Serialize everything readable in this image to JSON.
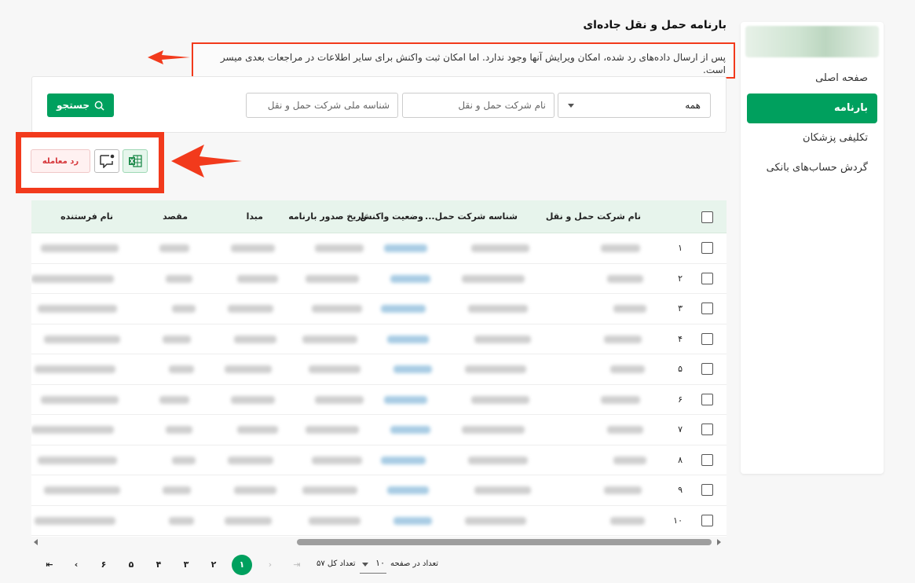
{
  "sidebar": {
    "items": [
      {
        "label": "صفحه اصلی",
        "active": false
      },
      {
        "label": "بارنامه",
        "active": true
      },
      {
        "label": "تکلیفی پزشکان",
        "active": false
      },
      {
        "label": "گردش حساب‌های بانکی",
        "active": false
      }
    ]
  },
  "header": {
    "title": "بارنامه حمل و نقل جاده‌ای",
    "notice": "پس از ارسال داده‌های رد شده، امکان ویرایش آنها وجود ندارد. اما امکان ثبت واکنش برای سایر اطلاعات در مراجعات بعدی میسر است."
  },
  "search": {
    "status_value": "همه",
    "company_placeholder": "نام شرکت حمل و نقل",
    "national_id_placeholder": "شناسه ملی شرکت حمل و نقل",
    "search_label": "جستجو"
  },
  "actions": {
    "reject_label": "رد معامله"
  },
  "table": {
    "columns": [
      "نام شرکت حمل و نقل",
      "شناسه شرکت حمل...",
      "وضعیت واکنش",
      "تاریخ صدور بارنامه",
      "مبدا",
      "مقصد",
      "نام فرستنده"
    ],
    "row_numbers": [
      "۱",
      "۲",
      "۳",
      "۴",
      "۵",
      "۶",
      "۷",
      "۸",
      "۹",
      "۱۰"
    ]
  },
  "pagination": {
    "pages": [
      "۶",
      "۵",
      "۴",
      "۳",
      "۲",
      "۱"
    ],
    "current": "۱",
    "page_size_label": "تعداد در صفحه",
    "page_size": "۱۰",
    "total_label": "تعداد کل ۵۷"
  },
  "colors": {
    "accent": "#00a05e",
    "highlight": "#f23a1c",
    "header_bg": "#e7f4ec"
  }
}
